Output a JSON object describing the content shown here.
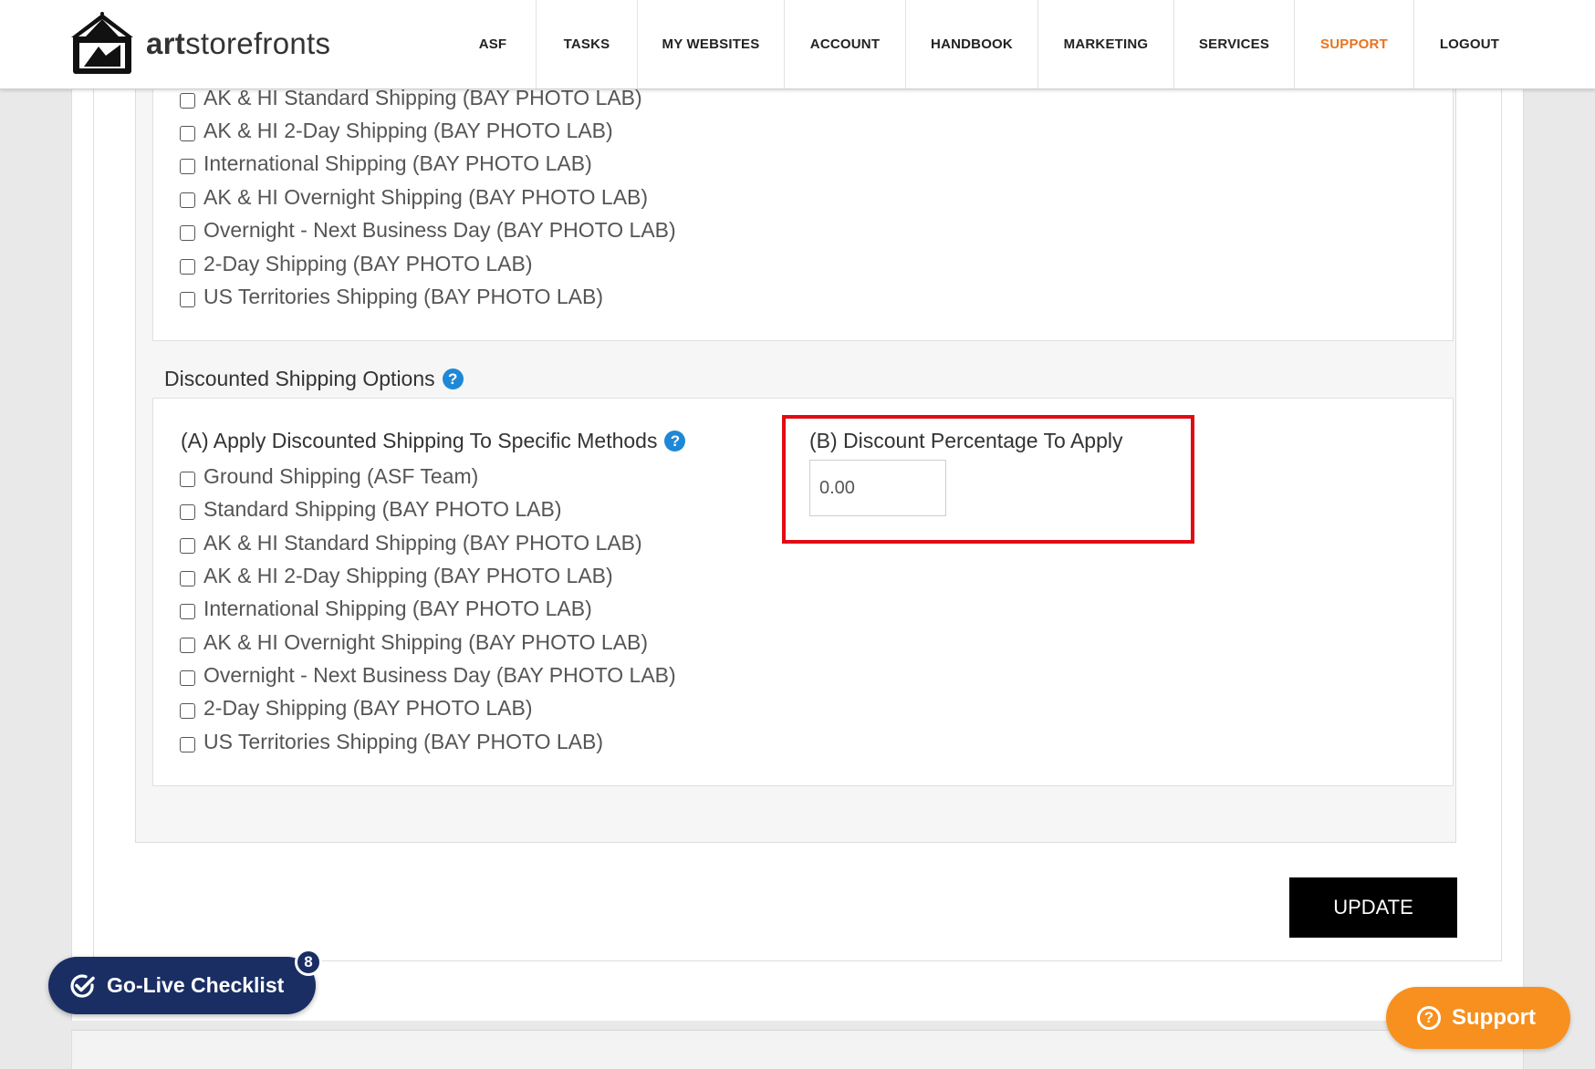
{
  "brand": {
    "logo_text_bold": "art",
    "logo_text_rest": "storefronts"
  },
  "nav": [
    {
      "label": "ASF",
      "key": "asf"
    },
    {
      "label": "TASKS",
      "key": "tasks"
    },
    {
      "label": "MY WEBSITES",
      "key": "my-websites"
    },
    {
      "label": "ACCOUNT",
      "key": "account"
    },
    {
      "label": "HANDBOOK",
      "key": "handbook"
    },
    {
      "label": "MARKETING",
      "key": "marketing"
    },
    {
      "label": "SERVICES",
      "key": "services"
    },
    {
      "label": "SUPPORT",
      "key": "support",
      "active": true
    },
    {
      "label": "LOGOUT",
      "key": "logout"
    }
  ],
  "upper_methods": [
    "AK & HI Standard Shipping (BAY PHOTO LAB)",
    "AK & HI 2-Day Shipping (BAY PHOTO LAB)",
    "International Shipping (BAY PHOTO LAB)",
    "AK & HI Overnight Shipping (BAY PHOTO LAB)",
    "Overnight - Next Business Day (BAY PHOTO LAB)",
    "2-Day Shipping (BAY PHOTO LAB)",
    "US Territories Shipping (BAY PHOTO LAB)"
  ],
  "discount": {
    "section_title": "Discounted Shipping Options",
    "a_title": "(A) Apply Discounted Shipping To Specific Methods",
    "a_methods": [
      "Ground Shipping (ASF Team)",
      "Standard Shipping (BAY PHOTO LAB)",
      "AK & HI Standard Shipping (BAY PHOTO LAB)",
      "AK & HI 2-Day Shipping (BAY PHOTO LAB)",
      "International Shipping (BAY PHOTO LAB)",
      "AK & HI Overnight Shipping (BAY PHOTO LAB)",
      "Overnight - Next Business Day (BAY PHOTO LAB)",
      "2-Day Shipping (BAY PHOTO LAB)",
      "US Territories Shipping (BAY PHOTO LAB)"
    ],
    "b_title": "(B) Discount Percentage To Apply",
    "b_value": "0.00",
    "help_glyph": "?"
  },
  "buttons": {
    "update": "UPDATE"
  },
  "golive": {
    "label": "Go-Live Checklist",
    "count": "8"
  },
  "support_widget": {
    "label": "Support",
    "icon": "?"
  },
  "colors": {
    "accent_orange": "#e8731c",
    "highlight_red": "#e20a12",
    "help_blue": "#1e88d6",
    "navy": "#1a2e64",
    "support_orange": "#f7901e"
  }
}
